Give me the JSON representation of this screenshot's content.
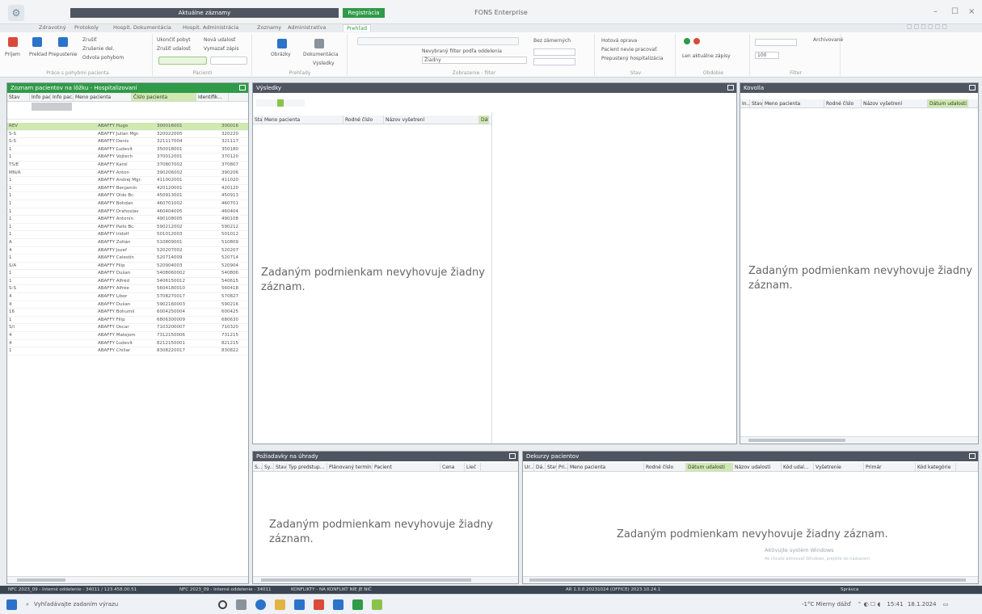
{
  "window": {
    "title": "FONS Enterprise",
    "context_tab_dark": "Aktuálne záznamy",
    "context_tab_green": "Registrácia",
    "minimize": "–",
    "maximize": "☐",
    "close": "×",
    "quick_access": "◻◻◻◻◻◻"
  },
  "ribbon_tabs": [
    "Zdravotný",
    "Protokoly",
    "Hospit. Dokumentácia",
    "Hospit. Administrácia",
    "Zoznamy",
    "Administratíva",
    "Prehľad"
  ],
  "ribbon": {
    "group1": {
      "label": "Práce s pohybmi pacienta",
      "buttons": [
        "Príjem",
        "Preklad",
        "Prepustenie"
      ],
      "small": [
        "Zrušiť",
        "Zrušenie del.",
        "Odvola pohybom"
      ]
    },
    "group2": {
      "label": "Pacienti",
      "small": [
        "Ukončiť pobyt",
        "Nová udalosť",
        "Zrušiť udalosť",
        "Vymazať zápis"
      ]
    },
    "group3": {
      "label": "Prehľady",
      "buttons": [
        "Obrázky",
        "Dokumentácia"
      ],
      "small": [
        "Výsledky"
      ]
    },
    "group4": {
      "label": "Zobrazenie - filter",
      "dropdown1": "Nevybraný filter podľa oddelenia",
      "dropdown2": "Žiadny",
      "small": [
        "Bez zámerných"
      ]
    },
    "group5": {
      "label": "Stav",
      "small": [
        "Hotová oprava",
        "Pacient nevie pracovať",
        "Prepustený hospitalizácia"
      ]
    },
    "group6": {
      "label": "Obdobie",
      "small": [
        "Len aktuálne zápisy"
      ]
    },
    "group7": {
      "label": "Filter",
      "small": [
        "Archivované"
      ],
      "value": "100"
    }
  },
  "patients_panel": {
    "title": "Zoznam pacientov na lôžku - Hospitalizovaní",
    "columns": [
      "Stav",
      "Info pac...",
      "Info pac...",
      "Meno pacienta",
      "Číslo pacienta",
      "Identifik..."
    ],
    "rows": [
      {
        "stav": "REV",
        "meno": "ABAFFY Hugo",
        "cislo": "300016001",
        "id": "300016"
      },
      {
        "stav": "S-S",
        "meno": "ABAFFY Julian Mgr.",
        "cislo": "320022005",
        "id": "320220"
      },
      {
        "stav": "S-S",
        "meno": "ABAFFY Denis",
        "cislo": "321117004",
        "id": "321117"
      },
      {
        "stav": "1",
        "meno": "ABAFFY Ľudevít",
        "cislo": "350018001",
        "id": "350180"
      },
      {
        "stav": "1",
        "meno": "ABAFFY Vojtech",
        "cislo": "370012001",
        "id": "370120"
      },
      {
        "stav": "TS/E",
        "meno": "ABAFFY Karol",
        "cislo": "370807002",
        "id": "370807"
      },
      {
        "stav": "MN/A",
        "meno": "ABAFFY Anton",
        "cislo": "390206002",
        "id": "390206"
      },
      {
        "stav": "1",
        "meno": "ABAFFY Andrej Mgr.",
        "cislo": "411002001",
        "id": "411020"
      },
      {
        "stav": "1",
        "meno": "ABAFFY Benjamín",
        "cislo": "420120001",
        "id": "420120"
      },
      {
        "stav": "1",
        "meno": "ABAFFY Oldo Bc.",
        "cislo": "450913001",
        "id": "450913"
      },
      {
        "stav": "1",
        "meno": "ABAFFY Bohdan",
        "cislo": "460701002",
        "id": "460701"
      },
      {
        "stav": "1",
        "meno": "ABAFFY Drahoslav",
        "cislo": "460404005",
        "id": "460404"
      },
      {
        "stav": "1",
        "meno": "ABAFFY Antonín",
        "cislo": "490108005",
        "id": "490108"
      },
      {
        "stav": "1",
        "meno": "ABAFFY Pallo Bc.",
        "cislo": "590212002",
        "id": "590212"
      },
      {
        "stav": "1",
        "meno": "ABAFFY Iridolf",
        "cislo": "501012003",
        "id": "501012"
      },
      {
        "stav": "A",
        "meno": "ABAFFY Zoltán",
        "cislo": "510809001",
        "id": "510809"
      },
      {
        "stav": "4",
        "meno": "ABAFFY Jozef",
        "cislo": "520207002",
        "id": "520207"
      },
      {
        "stav": "1",
        "meno": "ABAFFY Celestín",
        "cislo": "520714009",
        "id": "520714"
      },
      {
        "stav": "S/A",
        "meno": "ABAFFY Filip",
        "cislo": "520904003",
        "id": "520904"
      },
      {
        "stav": "1",
        "meno": "ABAFFY Dušan",
        "cislo": "5408060002",
        "id": "540806"
      },
      {
        "stav": "1",
        "meno": "ABAFFY Alfréd",
        "cislo": "5406150012",
        "id": "540615"
      },
      {
        "stav": "S-S",
        "meno": "ABAFFY Alfrée",
        "cislo": "5604180010",
        "id": "560418"
      },
      {
        "stav": "4",
        "meno": "ABAFFY Libor",
        "cislo": "5708270017",
        "id": "570827"
      },
      {
        "stav": "4",
        "meno": "ABAFFY Dušan",
        "cislo": "5902160003",
        "id": "590216"
      },
      {
        "stav": "16",
        "meno": "ABAFFY Bohumil",
        "cislo": "6004250004",
        "id": "600425"
      },
      {
        "stav": "1",
        "meno": "ABAFFY Filip",
        "cislo": "6806300009",
        "id": "680630"
      },
      {
        "stav": "S/I",
        "meno": "ABAFFY Oscar",
        "cislo": "7103200007",
        "id": "710320"
      },
      {
        "stav": "4",
        "meno": "ABAFFY Matejom",
        "cislo": "7312150006",
        "id": "731215"
      },
      {
        "stav": "4",
        "meno": "ABAFFY Ľudevít",
        "cislo": "8212150001",
        "id": "821215"
      },
      {
        "stav": "1",
        "meno": "ABAFFY Chiliar",
        "cislo": "8308220017",
        "id": "830822"
      }
    ]
  },
  "results_panel": {
    "title": "Výsledky",
    "columns": [
      "Stav",
      "Meno pacienta",
      "Rodné číslo",
      "Názov vyšetrení",
      "Dátu"
    ],
    "empty": "Zadaným podmienkam nevyhovuje žiadny záznam."
  },
  "kovolla_panel": {
    "title": "Kovolla",
    "columns": [
      "In...",
      "Stav",
      "Meno pacienta",
      "Rodné číslo",
      "Názov vyšetrení",
      "Dátum udalosti"
    ],
    "empty": "Zadaným podmienkam nevyhovuje žiadny záznam."
  },
  "requests_panel": {
    "title": "Požiadavky na úhrady",
    "columns": [
      "S...",
      "Sy...",
      "Stav",
      "Typ predstup...",
      "Plánovaný termín...",
      "Pacient",
      "Cena",
      "Lieč"
    ],
    "empty": "Zadaným podmienkam nevyhovuje žiadny záznam."
  },
  "reports_panel": {
    "title": "Dekurzy pacientov",
    "columns": [
      "Ur...",
      "Dá...",
      "Stav",
      "Pri...",
      "Meno pacienta",
      "Rodné číslo",
      "Dátum udalosti",
      "Názov udalosti",
      "Kód udal...",
      "Vyšetrenie",
      "Primár",
      "Kód kategórie"
    ],
    "empty": "Zadaným podmienkam nevyhovuje žiadny záznam."
  },
  "watermark": {
    "line1": "Aktivujte systém Windows",
    "line2": "Ak chcete aktivovať Windows, prejdite do nastavení."
  },
  "statusbar": {
    "items": [
      "NFC 2023_09 - Interné oddelenie - 34011 / 123.458.00.51",
      "NFC 2023_09 - Interné oddelenie - 34011",
      "KONFLIKTY - NA KONFLIKT NIE JE NIČ",
      "AR 1.0.0.20231024 (OFFICE) 2023.10.24.1",
      "Správca"
    ]
  },
  "taskbar": {
    "search": "Vyhľadávajte zadaním výrazu",
    "weather": "-1°C Mierny dážď",
    "time": "15:41",
    "date": "18.1.2024"
  }
}
